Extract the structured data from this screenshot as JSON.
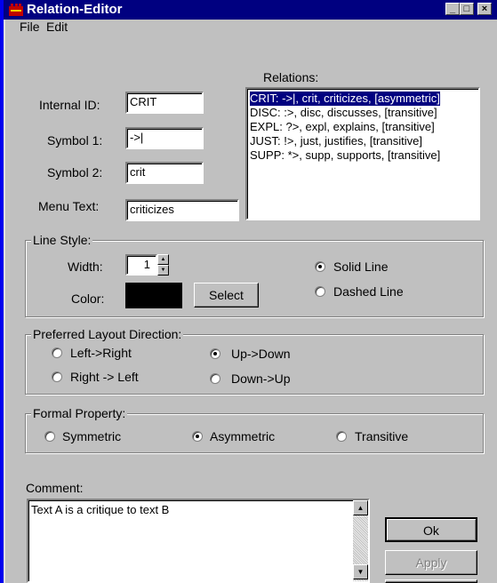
{
  "window": {
    "title": "Relation-Editor",
    "colors": {
      "titlebar": "#000080",
      "selection": "#000080",
      "background": "#c0c0c0"
    },
    "title_icon": "relation-app-icon",
    "controls": {
      "minimize": "_",
      "maximize": "□",
      "close": "×"
    }
  },
  "menu": {
    "file": "File",
    "edit": "Edit"
  },
  "form": {
    "internal_id_label": "Internal ID:",
    "internal_id_value": "CRIT",
    "symbol1_label": "Symbol 1:",
    "symbol1_value": "->|",
    "symbol2_label": "Symbol 2:",
    "symbol2_value": "crit",
    "menu_text_label": "Menu Text:",
    "menu_text_value": "criticizes"
  },
  "relations": {
    "label": "Relations:",
    "items": [
      "CRIT: ->|, crit, criticizes, [asymmetric]",
      "DISC: :>, disc, discusses, [transitive]",
      "EXPL: ?>, expl, explains, [transitive]",
      "JUST: !>, just, justifies, [transitive]",
      "SUPP: *>, supp, supports, [transitive]"
    ],
    "selected_index": 0
  },
  "line_style": {
    "title": "Line Style:",
    "width_label": "Width:",
    "width_value": "1",
    "color_label": "Color:",
    "color_value": "#000000",
    "select_button": "Select",
    "solid_label": "Solid Line",
    "dashed_label": "Dashed Line",
    "selected": "Solid Line"
  },
  "layout": {
    "title": "Preferred Layout Direction:",
    "left_right": "Left->Right",
    "right_left": "Right -> Left",
    "up_down": "Up->Down",
    "down_up": "Down->Up",
    "selected": "Up->Down"
  },
  "formal": {
    "title": "Formal Property:",
    "symmetric": "Symmetric",
    "asymmetric": "Asymmetric",
    "transitive": "Transitive",
    "selected": "Asymmetric"
  },
  "comment": {
    "label": "Comment:",
    "value": "Text A is a critique to text B"
  },
  "buttons": {
    "ok": "Ok",
    "apply": "Apply"
  }
}
